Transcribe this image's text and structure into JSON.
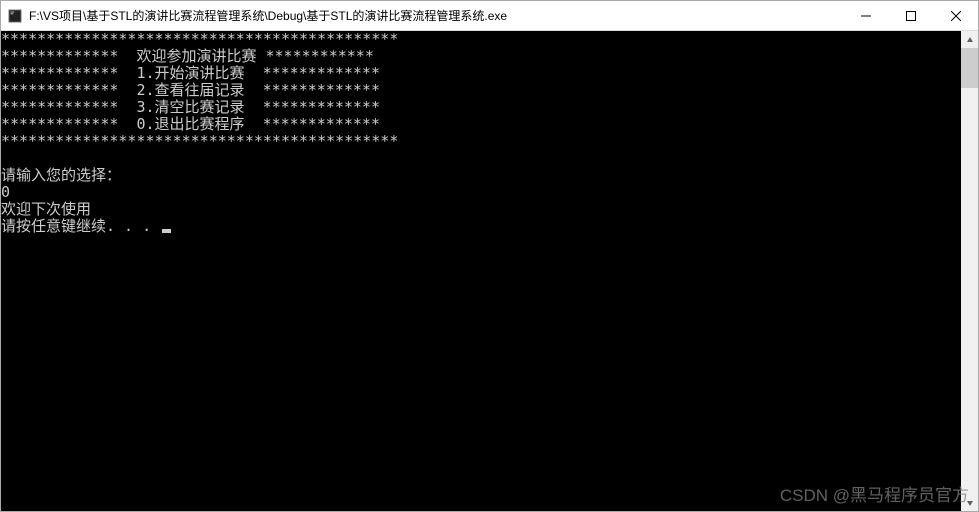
{
  "window": {
    "title": "F:\\VS项目\\基于STL的演讲比赛流程管理系统\\Debug\\基于STL的演讲比赛流程管理系统.exe"
  },
  "console": {
    "lines": [
      "********************************************",
      "*************  欢迎参加演讲比赛 ************",
      "*************  1.开始演讲比赛  *************",
      "*************  2.查看往届记录  *************",
      "*************  3.清空比赛记录  *************",
      "*************  0.退出比赛程序  *************",
      "********************************************",
      "",
      "请输入您的选择：",
      "0",
      "欢迎下次使用",
      "请按任意键继续. . . "
    ]
  },
  "watermark": "CSDN @黑马程序员官方"
}
